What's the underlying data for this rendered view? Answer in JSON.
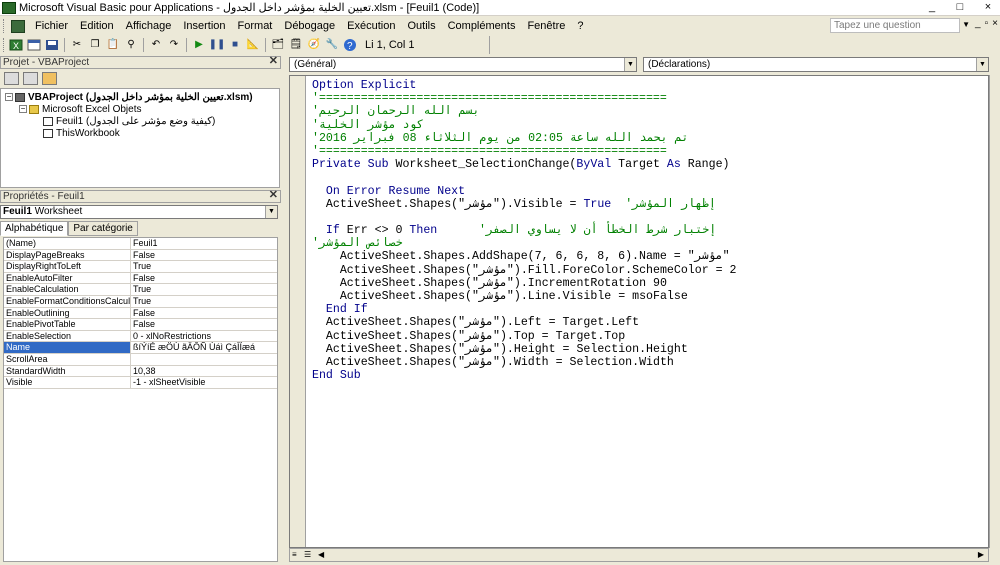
{
  "window": {
    "title": "Microsoft Visual Basic pour Applications - تعيين الخلية بمؤشر داخل الجدول.xlsm - [Feuil1 (Code)]",
    "controls": [
      "_",
      "□",
      "×"
    ]
  },
  "menubar": {
    "items": [
      "Fichier",
      "Edition",
      "Affichage",
      "Insertion",
      "Format",
      "Débogage",
      "Exécution",
      "Outils",
      "Compléments",
      "Fenêtre",
      "?"
    ],
    "question_placeholder": "Tapez une question",
    "mdi_controls": [
      "_",
      "▫",
      "×"
    ]
  },
  "toolbar": {
    "buttons": [
      "excel-view-icon",
      "insert-userform-icon",
      "save-icon",
      "cut-icon",
      "copy-icon",
      "paste-icon",
      "find-icon",
      "undo-icon",
      "redo-icon",
      "run-icon",
      "break-icon",
      "reset-icon",
      "design-mode-icon",
      "project-explorer-icon",
      "properties-icon",
      "object-browser-icon",
      "toolbox-icon",
      "help-icon"
    ],
    "cursor_position": "Li 1, Col 1"
  },
  "project_pane": {
    "title": "Projet - VBAProject",
    "tree": [
      {
        "label": "VBAProject (تعيين الخلية بمؤشر داخل الجدول.xlsm)",
        "bold": true,
        "icon": "project-icon"
      },
      {
        "label": "Microsoft Excel Objets",
        "bold": false,
        "icon": "folder-icon"
      },
      {
        "label": "Feuil1 (كيفية وضع مؤشر على الجدول)",
        "bold": false,
        "icon": "sheet-icon"
      },
      {
        "label": "ThisWorkbook",
        "bold": false,
        "icon": "workbook-icon"
      }
    ]
  },
  "properties_pane": {
    "title": "Propriétés - Feuil1",
    "object_name": "Feuil1",
    "object_type": "Worksheet",
    "tabs": [
      "Alphabétique",
      "Par catégorie"
    ],
    "rows": [
      {
        "name": "(Name)",
        "value": "Feuil1"
      },
      {
        "name": "DisplayPageBreaks",
        "value": "False"
      },
      {
        "name": "DisplayRightToLeft",
        "value": "True"
      },
      {
        "name": "EnableAutoFilter",
        "value": "False"
      },
      {
        "name": "EnableCalculation",
        "value": "True"
      },
      {
        "name": "EnableFormatConditionsCalculation",
        "value": "True"
      },
      {
        "name": "EnableOutlining",
        "value": "False"
      },
      {
        "name": "EnablePivotTable",
        "value": "False"
      },
      {
        "name": "EnableSelection",
        "value": "0 - xlNoRestrictions"
      },
      {
        "name": "Name",
        "value": "ßíÝíÉ æÖÚ ãÄÔÑ Úáì ÇáÌÏæá",
        "selected": true
      },
      {
        "name": "ScrollArea",
        "value": ""
      },
      {
        "name": "StandardWidth",
        "value": "10,38"
      },
      {
        "name": "Visible",
        "value": "-1 - xlSheetVisible"
      }
    ]
  },
  "code_window": {
    "object_combo": "(Général)",
    "procedure_combo": "(Déclarations)",
    "lines": [
      [
        {
          "t": "Option Explicit",
          "c": "kw"
        }
      ],
      [
        {
          "t": "'==================================================",
          "c": "cm"
        }
      ],
      [
        {
          "t": "'بسم الله الرحمان الرحيم",
          "c": "cm"
        }
      ],
      [
        {
          "t": "'كود مؤشر الخلية",
          "c": "cm"
        }
      ],
      [
        {
          "t": "'تم بحمد الله ساعة 02:05 من يوم الثلاثاء 08 فبراير 2016",
          "c": "cm"
        }
      ],
      [
        {
          "t": "'==================================================",
          "c": "cm"
        }
      ],
      [
        {
          "t": "Private Sub ",
          "c": "kw"
        },
        {
          "t": "Worksheet_SelectionChange(",
          "c": "tx"
        },
        {
          "t": "ByVal ",
          "c": "kw"
        },
        {
          "t": "Target ",
          "c": "tx"
        },
        {
          "t": "As ",
          "c": "kw"
        },
        {
          "t": "Range)",
          "c": "tx"
        }
      ],
      [
        {
          "t": "",
          "c": "tx"
        }
      ],
      [
        {
          "t": "  On Error Resume Next",
          "c": "kw"
        }
      ],
      [
        {
          "t": "  ActiveSheet.Shapes(\"مؤشر\").Visible = ",
          "c": "tx"
        },
        {
          "t": "True",
          "c": "kw"
        },
        {
          "t": "  'إظهار المؤشر",
          "c": "cm"
        }
      ],
      [
        {
          "t": "",
          "c": "tx"
        }
      ],
      [
        {
          "t": "  If ",
          "c": "kw"
        },
        {
          "t": "Err <> 0 ",
          "c": "tx"
        },
        {
          "t": "Then",
          "c": "kw"
        },
        {
          "t": "      'إختبار شرط الخطأ أن لا يساوي الصفر",
          "c": "cm"
        }
      ],
      [
        {
          "t": "'خصائص المؤشر",
          "c": "cm"
        }
      ],
      [
        {
          "t": "    ActiveSheet.Shapes.AddShape(7, 6, 6, 8, 6).Name = \"مؤشر\"",
          "c": "tx"
        }
      ],
      [
        {
          "t": "    ActiveSheet.Shapes(\"مؤشر\").Fill.ForeColor.SchemeColor = 2",
          "c": "tx"
        }
      ],
      [
        {
          "t": "    ActiveSheet.Shapes(\"مؤشر\").IncrementRotation 90",
          "c": "tx"
        }
      ],
      [
        {
          "t": "    ActiveSheet.Shapes(\"مؤشر\").Line.Visible = msoFalse",
          "c": "tx"
        }
      ],
      [
        {
          "t": "  End If",
          "c": "kw"
        }
      ],
      [
        {
          "t": "  ActiveSheet.Shapes(\"مؤشر\").Left = Target.Left",
          "c": "tx"
        }
      ],
      [
        {
          "t": "  ActiveSheet.Shapes(\"مؤشر\").Top = Target.Top",
          "c": "tx"
        }
      ],
      [
        {
          "t": "  ActiveSheet.Shapes(\"مؤشر\").Height = Selection.Height",
          "c": "tx"
        }
      ],
      [
        {
          "t": "  ActiveSheet.Shapes(\"مؤشر\").Width = Selection.Width",
          "c": "tx"
        }
      ],
      [
        {
          "t": "End Sub",
          "c": "kw"
        }
      ]
    ]
  },
  "colors": {
    "keyword": "#00008b",
    "comment": "#008000",
    "selection": "#316ac5",
    "chrome": "#ece9d8"
  }
}
